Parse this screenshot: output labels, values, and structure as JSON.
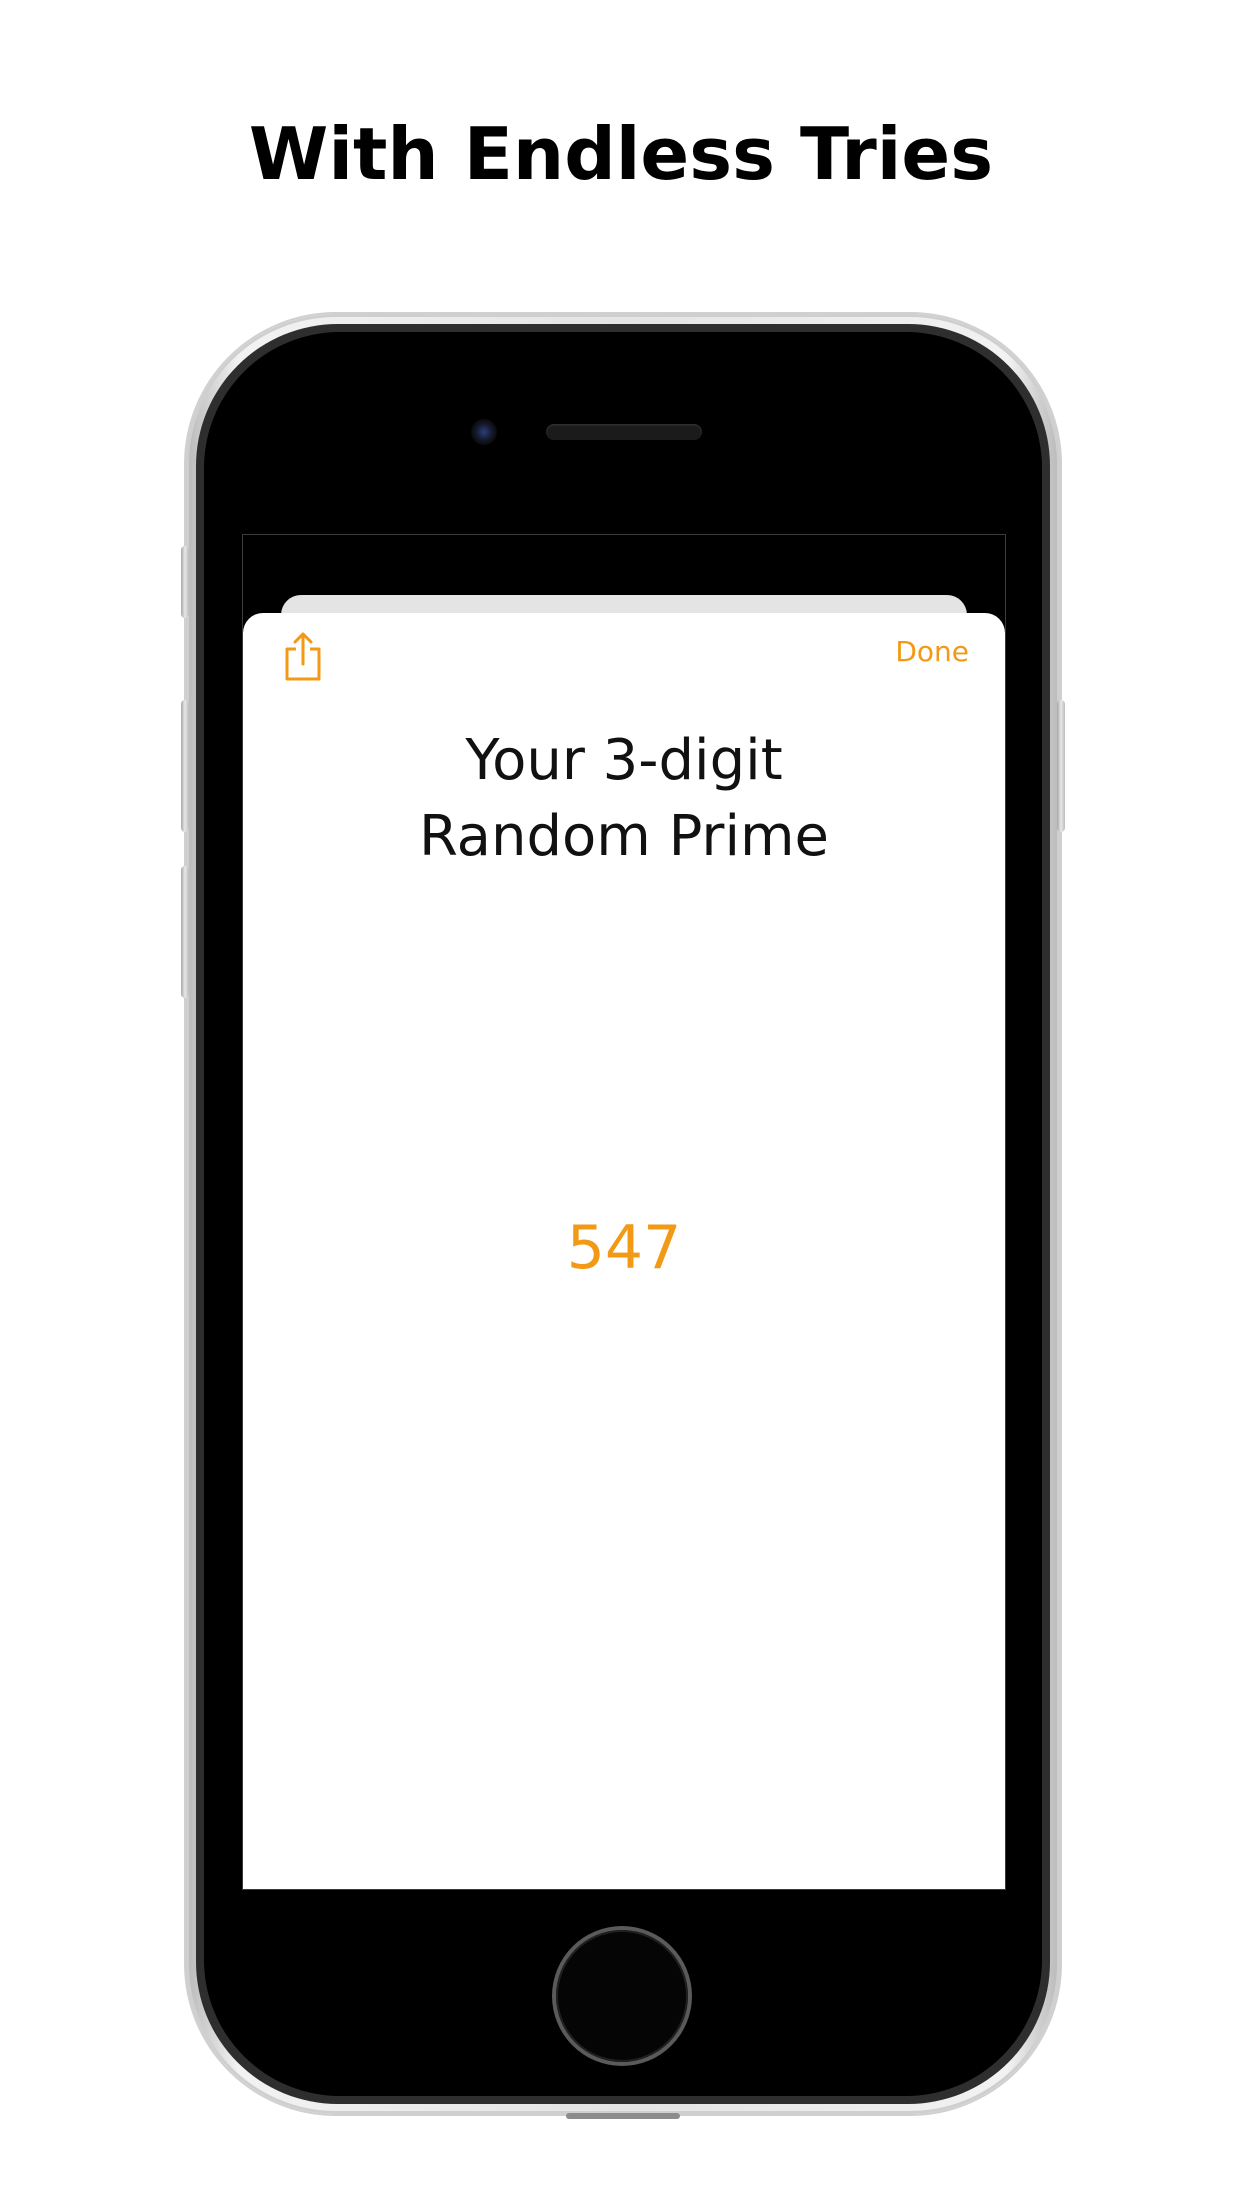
{
  "headline": "With Endless Tries",
  "sheet": {
    "done_label": "Done",
    "title_line1": "Your 3-digit",
    "title_line2": "Random Prime",
    "prime_value": "547",
    "share_icon": "share-icon"
  },
  "colors": {
    "accent": "#f29a15",
    "title_text": "#111111",
    "headline_text": "#000000"
  }
}
